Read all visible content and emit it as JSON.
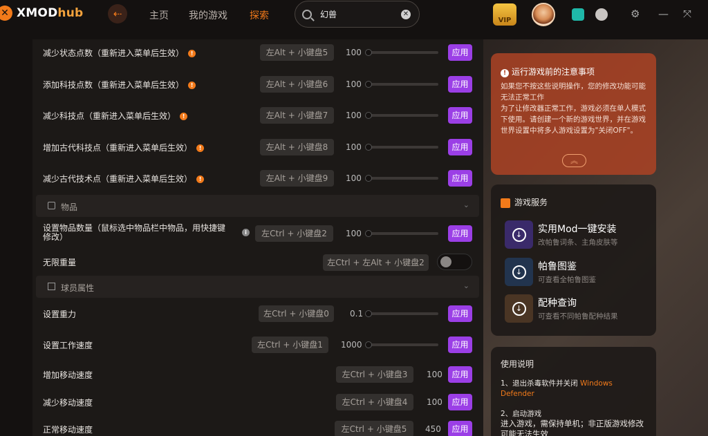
{
  "app": {
    "brand_x": "XMOD",
    "brand_hub": "hub"
  },
  "nav": {
    "home": "主页",
    "my_games": "我的游戏",
    "explore": "探索"
  },
  "search": {
    "value": "幻兽"
  },
  "topbar": {
    "vip_label": "VIP"
  },
  "rows": [
    {
      "label": "减少状态点数（重新进入菜单后生效）",
      "hotkey": "左Alt + 小键盘5",
      "value": "100",
      "apply": "应用"
    },
    {
      "label": "添加科技点数（重新进入菜单后生效）",
      "hotkey": "左Alt + 小键盘6",
      "value": "100",
      "apply": "应用"
    },
    {
      "label": "减少科技点（重新进入菜单后生效）",
      "hotkey": "左Alt + 小键盘7",
      "value": "100",
      "apply": "应用"
    },
    {
      "label": "增加古代科技点（重新进入菜单后生效）",
      "hotkey": "左Alt + 小键盘8",
      "value": "100",
      "apply": "应用"
    },
    {
      "label": "减少古代技术点（重新进入菜单后生效）",
      "hotkey": "左Alt + 小键盘9",
      "value": "100",
      "apply": "应用"
    }
  ],
  "section_items": {
    "title": "物品"
  },
  "items_rows": [
    {
      "label_line1": "设置物品数量（鼠标选中物品栏中物品，用快捷键",
      "label_line2": "修改）",
      "hotkey": "左Ctrl + 小键盘2",
      "value": "100",
      "apply": "应用"
    },
    {
      "label": "无限重量",
      "hotkey": "左Ctrl + 左Alt + 小键盘2"
    }
  ],
  "section_player": {
    "title": "球员属性"
  },
  "player_rows": [
    {
      "label": "设置重力",
      "hotkey": "左Ctrl + 小键盘0",
      "value": "0.1",
      "apply": "应用"
    },
    {
      "label": "设置工作速度",
      "hotkey": "左Ctrl + 小键盘1",
      "value": "1000",
      "apply": "应用"
    },
    {
      "label": "增加移动速度",
      "hotkey": "左Ctrl + 小键盘3",
      "value": "100",
      "apply": "应用"
    },
    {
      "label": "减少移动速度",
      "hotkey": "左Ctrl + 小键盘4",
      "value": "100",
      "apply": "应用"
    },
    {
      "label": "正常移动速度",
      "hotkey": "左Ctrl + 小键盘5",
      "value": "450",
      "apply": "应用"
    }
  ],
  "notice": {
    "title": "运行游戏前的注意事项",
    "line1": "如果您不按这些说明操作，您的修改功能可能无法正常工作",
    "line2": "为了让修改器正常工作，游戏必须在单人模式下使用。请创建一个新的游戏世界，并在游戏世界设置中将多人游戏设置为\"关闭OFF\"。"
  },
  "services": {
    "title": "游戏服务",
    "items": [
      {
        "title": "实用Mod一键安装",
        "sub": "改帕鲁词条、主角皮肤等"
      },
      {
        "title": "帕鲁图鉴",
        "sub": "可查看全帕鲁图鉴"
      },
      {
        "title": "配种查询",
        "sub": "可查看不同帕鲁配种结果"
      }
    ]
  },
  "usage": {
    "title": "使用说明",
    "step1": "1、退出杀毒软件并关闭",
    "step1_hl": "Windows Defender",
    "step2": "2、启动游戏",
    "step2_body": "进入游戏，需保持单机；非正版游戏修改可能无法生效"
  },
  "colors": {
    "accent": "#f27a1a",
    "apply": "#9b3fe6",
    "notice": "#a84224"
  }
}
